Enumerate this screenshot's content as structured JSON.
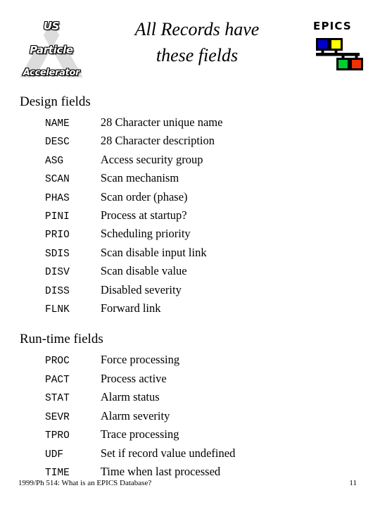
{
  "header": {
    "uspas_logo": {
      "name": "us-particle-accelerator-logo",
      "lines": [
        "US",
        "Particle",
        "Accelerator"
      ],
      "triangle_color": "#d9d9d9"
    },
    "title": {
      "line1": "All Records have",
      "line2": "these fields"
    },
    "epics_logo": {
      "wordmark": "EPICS",
      "nodes": [
        {
          "name": "node-blue",
          "color": "#0000cc"
        },
        {
          "name": "node-yellow",
          "color": "#ffff00"
        },
        {
          "name": "node-green",
          "color": "#00cc33"
        },
        {
          "name": "node-red",
          "color": "#ee3300"
        }
      ],
      "line_color": "#000000"
    }
  },
  "sections": [
    {
      "id": "design",
      "heading": "Design fields",
      "fields": [
        {
          "name": "NAME",
          "desc": "28 Character unique name"
        },
        {
          "name": "DESC",
          "desc": "28 Character description"
        },
        {
          "name": "ASG",
          "desc": "Access security group"
        },
        {
          "name": "SCAN",
          "desc": "Scan mechanism"
        },
        {
          "name": "PHAS",
          "desc": "Scan order (phase)"
        },
        {
          "name": "PINI",
          "desc": "Process at startup?"
        },
        {
          "name": "PRIO",
          "desc": "Scheduling priority"
        },
        {
          "name": "SDIS",
          "desc": "Scan disable input link"
        },
        {
          "name": "DISV",
          "desc": "Scan disable value"
        },
        {
          "name": "DISS",
          "desc": "Disabled severity"
        },
        {
          "name": "FLNK",
          "desc": "Forward link"
        }
      ]
    },
    {
      "id": "runtime",
      "heading": "Run-time fields",
      "fields": [
        {
          "name": "PROC",
          "desc": "Force processing"
        },
        {
          "name": "PACT",
          "desc": "Process active"
        },
        {
          "name": "STAT",
          "desc": "Alarm status"
        },
        {
          "name": "SEVR",
          "desc": "Alarm severity"
        },
        {
          "name": "TPRO",
          "desc": "Trace processing"
        },
        {
          "name": "UDF",
          "desc": "Set if record value undefined"
        },
        {
          "name": "TIME",
          "desc": "Time when last processed"
        }
      ]
    }
  ],
  "footer": {
    "note": "1999/Ph 514: What is an EPICS Database?",
    "page": "11"
  }
}
